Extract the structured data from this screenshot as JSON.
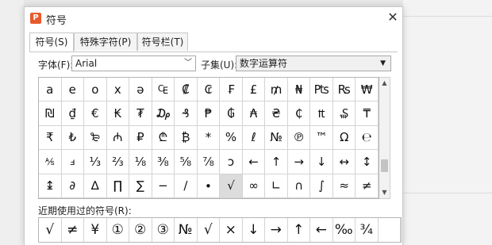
{
  "dialog": {
    "title": "符号",
    "app_icon_glyph": "P",
    "close_glyph": "✕"
  },
  "tabs": [
    {
      "label": "符号(S)",
      "active": true
    },
    {
      "label": "特殊字符(P)",
      "active": false
    },
    {
      "label": "符号栏(T)",
      "active": false
    }
  ],
  "font": {
    "label": "字体(F):",
    "value": "Arial"
  },
  "subset": {
    "label": "子集(U):",
    "value": "数字运算符"
  },
  "symbols": [
    "a",
    "e",
    "o",
    "x",
    "ə",
    "₠",
    "₡",
    "₢",
    "₣",
    "£",
    "₥",
    "₦",
    "₧",
    "₨",
    "₩",
    "₪",
    "₫",
    "€",
    "₭",
    "₮",
    "₯",
    "₰",
    "₱",
    "₲",
    "₳",
    "₴",
    "₵",
    "₶",
    "₷",
    "₸",
    "₹",
    "₺",
    "₻",
    "₼",
    "₽",
    "₾",
    "₿",
    "*",
    "%",
    "ℓ",
    "№",
    "℗",
    "™",
    "Ω",
    "℮",
    "⅍",
    "ⅎ",
    "⅓",
    "⅔",
    "⅛",
    "⅜",
    "⅝",
    "⅞",
    "ↄ",
    "←",
    "↑",
    "→",
    "↓",
    "↔",
    "↕",
    "↨",
    "∂",
    "∆",
    "∏",
    "∑",
    "−",
    "∕",
    "∙",
    "√",
    "∞",
    "∟",
    "∩",
    "∫",
    "≈",
    "≠"
  ],
  "selected_symbol_index": 68,
  "recent": {
    "label": "近期使用过的符号(R):",
    "symbols": [
      "√",
      "≠",
      "¥",
      "①",
      "②",
      "③",
      "№",
      "√",
      "×",
      "↓",
      "→",
      "↑",
      "←",
      "‰",
      "¾",
      ""
    ]
  },
  "colors": {
    "app_icon": "#e8592b",
    "selected_cell": "#dcdcdc",
    "grid_line": "#d4d4d4"
  }
}
